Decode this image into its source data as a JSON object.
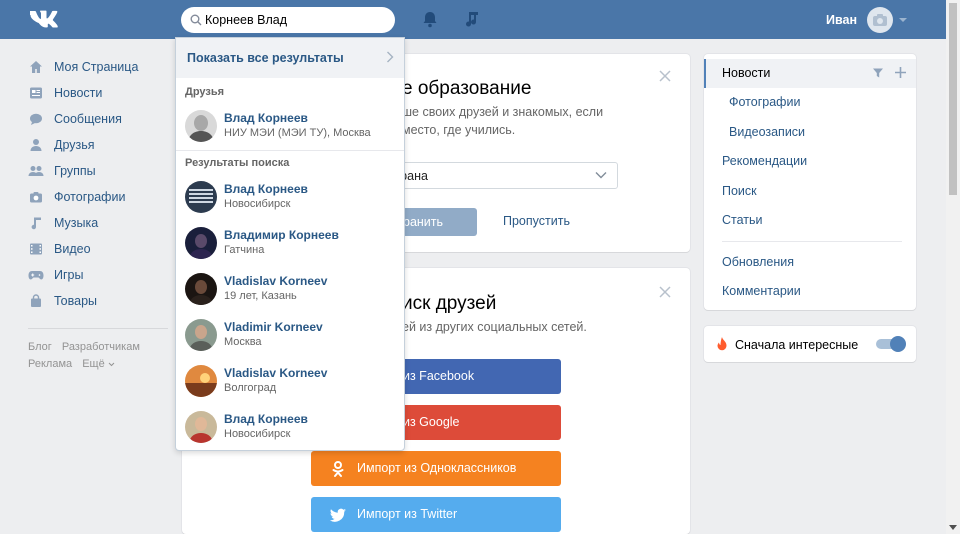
{
  "header": {
    "logo": "VK",
    "search_value": "Корнеев Влад",
    "user_name": "Иван"
  },
  "leftnav": {
    "items": [
      {
        "label": "Моя Страница",
        "icon": "home-icon"
      },
      {
        "label": "Новости",
        "icon": "news-icon"
      },
      {
        "label": "Сообщения",
        "icon": "messages-icon"
      },
      {
        "label": "Друзья",
        "icon": "friends-icon"
      },
      {
        "label": "Группы",
        "icon": "groups-icon"
      },
      {
        "label": "Фотографии",
        "icon": "photos-icon"
      },
      {
        "label": "Музыка",
        "icon": "music-icon"
      },
      {
        "label": "Видео",
        "icon": "video-icon"
      },
      {
        "label": "Игры",
        "icon": "games-icon"
      },
      {
        "label": "Товары",
        "icon": "market-icon"
      }
    ],
    "footer": [
      "Блог",
      "Разработчикам",
      "Реклама",
      "Ещё"
    ]
  },
  "card1": {
    "title": "е образование",
    "text_line1": "ше своих друзей и знакомых, если",
    "text_line2": "место, где учились.",
    "select_value": "брана",
    "save_label": "ранить",
    "skip_label": "Пропустить"
  },
  "card2": {
    "title": "иск друзей",
    "text": "ей из других социальных сетей.",
    "buttons": [
      {
        "label": "из Facebook",
        "color": "#4267b2",
        "icon": "facebook-icon"
      },
      {
        "label": "из Google",
        "color": "#dd4b39",
        "icon": "google-icon"
      },
      {
        "label": "Импорт из Одноклассников",
        "color": "#f58220",
        "icon": "odnoklassniki-icon"
      },
      {
        "label": "Импорт из Twitter",
        "color": "#55acee",
        "icon": "twitter-icon"
      }
    ]
  },
  "rightpanel": {
    "items": [
      {
        "label": "Новости"
      },
      {
        "label": "Фотографии"
      },
      {
        "label": "Видеозаписи"
      },
      {
        "label": "Рекомендации"
      },
      {
        "label": "Поиск"
      },
      {
        "label": "Статьи"
      },
      {
        "label": "Обновления"
      },
      {
        "label": "Комментарии"
      }
    ],
    "interesting_first": "Сначала интересные",
    "toggle_on": true
  },
  "dropdown": {
    "show_all": "Показать все результаты",
    "friends_header": "Друзья",
    "results_header": "Результаты поиска",
    "friends": [
      {
        "name": "Влад Корнеев",
        "sub": "НИУ МЭИ (МЭИ ТУ), Москва"
      }
    ],
    "results": [
      {
        "name": "Влад Корнеев",
        "sub": "Новосибирск"
      },
      {
        "name": "Владимир Корнеев",
        "sub": "Гатчина"
      },
      {
        "name": "Vladislav Korneev",
        "sub": "19 лет, Казань"
      },
      {
        "name": "Vladimir Korneev",
        "sub": "Москва"
      },
      {
        "name": "Vladislav Korneev",
        "sub": "Волгоград"
      },
      {
        "name": "Влад Корнеев",
        "sub": "Новосибирск"
      }
    ]
  },
  "colors": {
    "header_bg": "#4a76a8",
    "link": "#2a5885",
    "page_bg": "#edeef0"
  }
}
